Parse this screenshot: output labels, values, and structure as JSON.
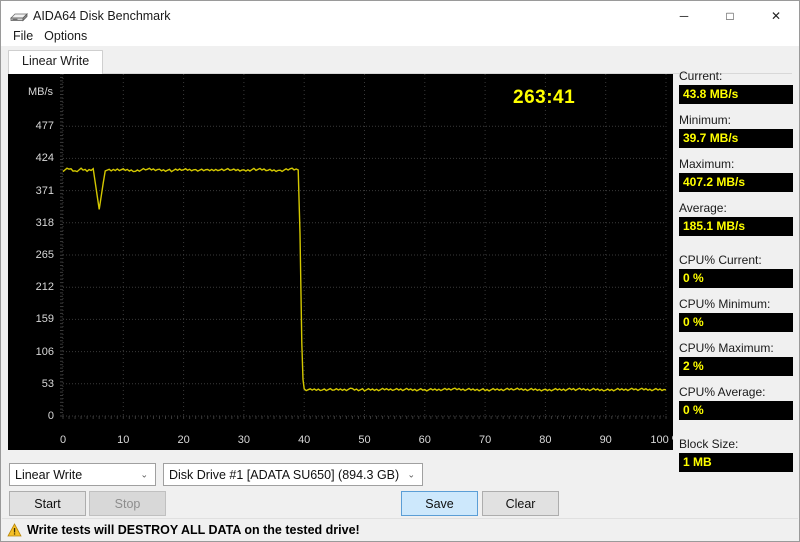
{
  "window": {
    "title": "AIDA64 Disk Benchmark",
    "icon": "disk-drive-icon",
    "minimize": "─",
    "maximize": "□",
    "close": "✕"
  },
  "menu": {
    "items": [
      {
        "label": "File"
      },
      {
        "label": "Options"
      }
    ]
  },
  "tabs": [
    {
      "label": "Linear Write",
      "active": true
    }
  ],
  "chart": {
    "timer": "263:41",
    "axis_title": "MB/s"
  },
  "chart_data": {
    "type": "line",
    "title": "Linear Write",
    "xlabel": "%",
    "ylabel": "MB/s",
    "xlim": [
      0,
      100
    ],
    "ylim": [
      0,
      530
    ],
    "grid": true,
    "legend": "none",
    "line_color": "#d4c800",
    "background": "#000000",
    "y_ticks": [
      0,
      53,
      106,
      159,
      212,
      265,
      318,
      371,
      424,
      477
    ],
    "y_tick_labels": [
      "0",
      "53",
      "106",
      "159",
      "212",
      "265",
      "318",
      "371",
      "424",
      "477"
    ],
    "x_ticks": [
      0,
      10,
      20,
      30,
      40,
      50,
      60,
      70,
      80,
      90,
      100
    ],
    "x_tick_labels": [
      "0",
      "10",
      "20",
      "30",
      "40",
      "50",
      "60",
      "70",
      "80",
      "90",
      "100 %"
    ],
    "annotations": [
      {
        "text": "263:41",
        "x": 76,
        "y": 500,
        "color": "#ffff00"
      }
    ],
    "series": [
      {
        "name": "Linear Write",
        "x": [
          0,
          1,
          2,
          3,
          4,
          5,
          6,
          7,
          8,
          9,
          10,
          12,
          14,
          16,
          18,
          20,
          22,
          24,
          26,
          28,
          30,
          32,
          34,
          36,
          38,
          39,
          39.3,
          39.5,
          39.6,
          39.8,
          40,
          41,
          43,
          45,
          48,
          50,
          55,
          60,
          65,
          70,
          75,
          80,
          85,
          90,
          95,
          100
        ],
        "y": [
          404,
          407,
          403,
          406,
          404,
          407,
          340,
          405,
          404,
          406,
          405,
          404,
          406,
          405,
          404,
          406,
          405,
          404,
          406,
          405,
          404,
          406,
          405,
          404,
          406,
          405,
          300,
          180,
          120,
          60,
          44,
          43,
          44,
          43,
          44,
          43,
          44,
          43,
          44,
          43,
          44,
          43,
          44,
          43,
          44,
          43
        ]
      }
    ]
  },
  "stats": [
    {
      "label": "Current:",
      "value": "43.8 MB/s",
      "gap": false
    },
    {
      "label": "Minimum:",
      "value": "39.7 MB/s",
      "gap": false
    },
    {
      "label": "Maximum:",
      "value": "407.2 MB/s",
      "gap": false
    },
    {
      "label": "Average:",
      "value": "185.1 MB/s",
      "gap": false
    },
    {
      "label": "CPU% Current:",
      "value": "0 %",
      "gap": true
    },
    {
      "label": "CPU% Minimum:",
      "value": "0 %",
      "gap": false
    },
    {
      "label": "CPU% Maximum:",
      "value": "2 %",
      "gap": false
    },
    {
      "label": "CPU% Average:",
      "value": "0 %",
      "gap": false
    },
    {
      "label": "Block Size:",
      "value": "1 MB",
      "gap": true
    }
  ],
  "controls": {
    "mode_combo": {
      "value": "Linear Write",
      "caret": "⌄"
    },
    "drive_combo": {
      "value": "Disk Drive #1  [ADATA SU650]  (894.3 GB)",
      "caret": "⌄"
    },
    "start_button": "Start",
    "stop_button": "Stop",
    "save_button": "Save",
    "clear_button": "Clear"
  },
  "warning": {
    "icon": "warning-triangle-icon",
    "text": "Write tests will DESTROY ALL DATA on the tested drive!"
  }
}
